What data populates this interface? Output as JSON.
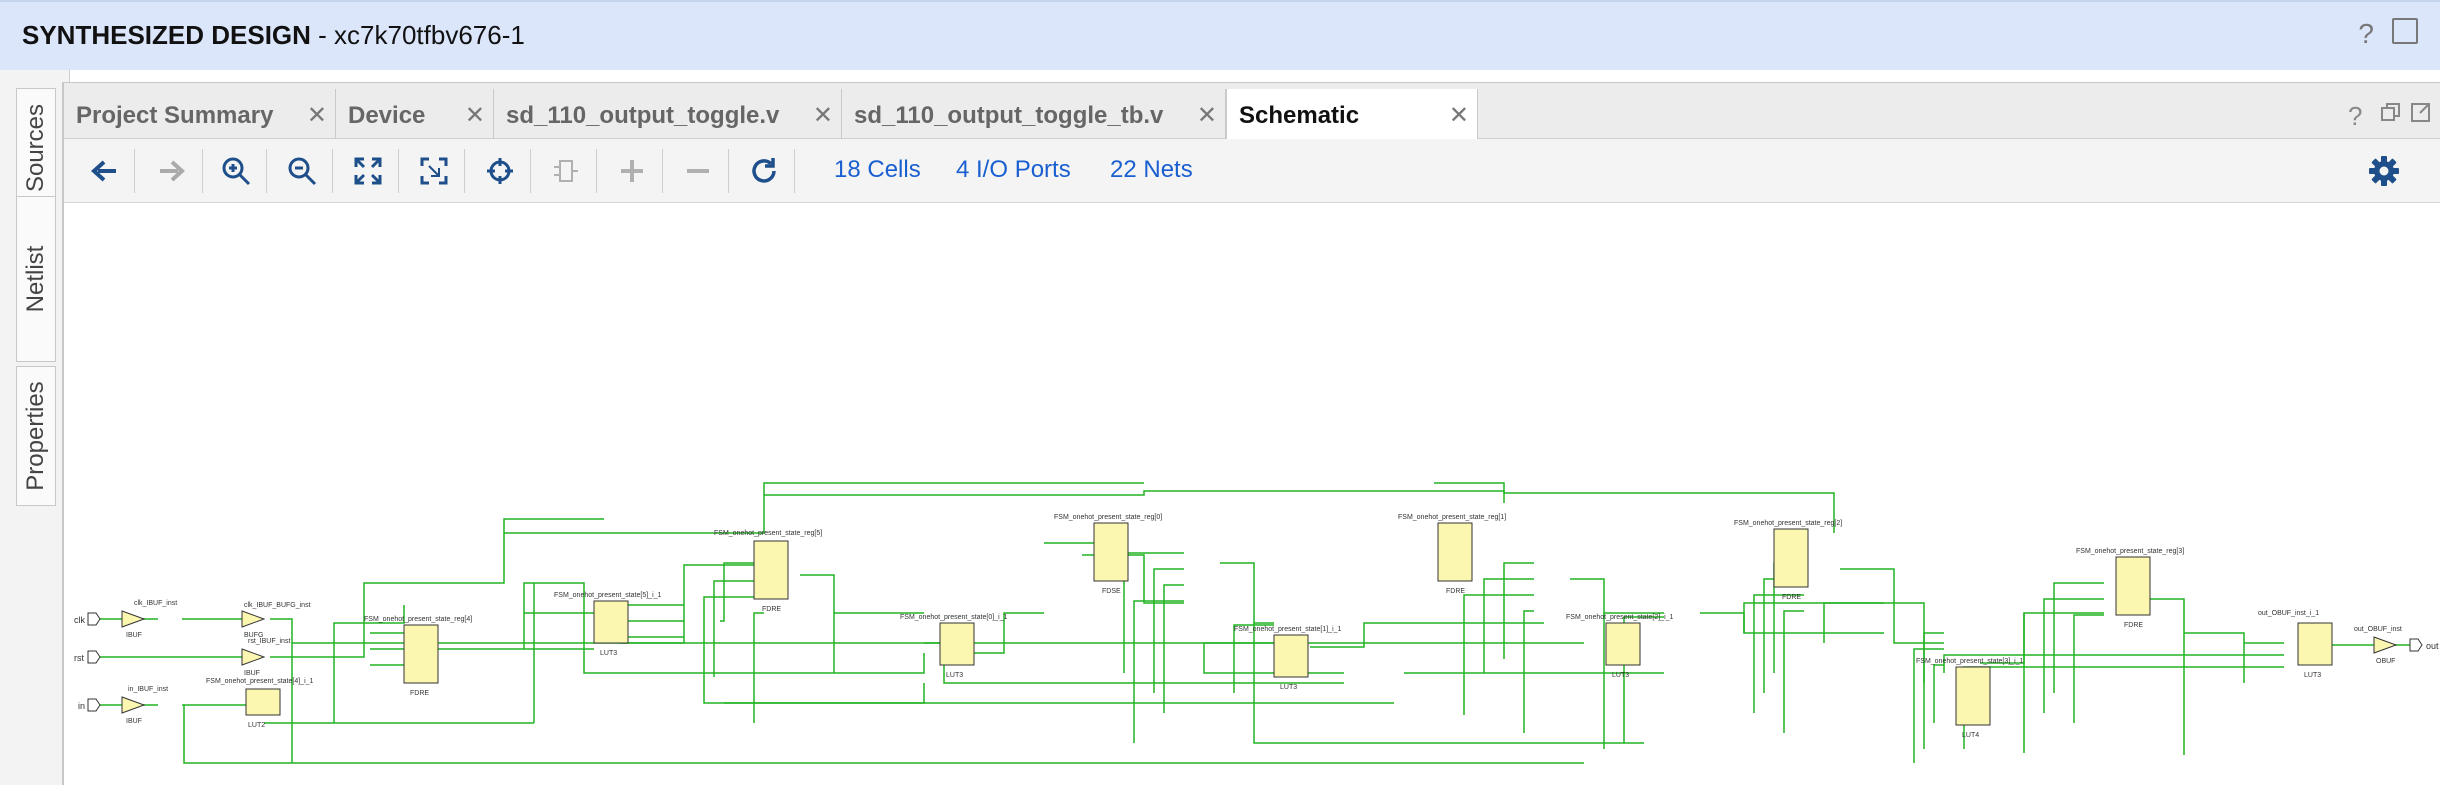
{
  "window": {
    "title_bold": "SYNTHESIZED DESIGN",
    "title_rest": " - xc7k70tfbv676-1",
    "help": "?"
  },
  "side_tabs": [
    {
      "label": "Sources"
    },
    {
      "label": "Netlist"
    },
    {
      "label": "Properties"
    }
  ],
  "tabs": [
    {
      "label": "Project Summary",
      "active": false
    },
    {
      "label": "Device",
      "active": false
    },
    {
      "label": "sd_110_output_toggle.v",
      "active": false
    },
    {
      "label": "sd_110_output_toggle_tb.v",
      "active": false
    },
    {
      "label": "Schematic",
      "active": true
    }
  ],
  "tab_controls": {
    "help": "?"
  },
  "toolbar": {
    "buttons": [
      "back-icon",
      "forward-icon",
      "zoom-in-icon",
      "zoom-out-icon",
      "zoom-fit-icon",
      "zoom-area-icon",
      "select-icon",
      "expand-cell-icon",
      "add-icon",
      "remove-icon",
      "refresh-icon"
    ],
    "cells": "18 Cells",
    "ports": "4 I/O Ports",
    "nets": "22 Nets",
    "settings_icon": "gear-icon"
  },
  "colors": {
    "wire": "#22b322",
    "cell_fill": "#fbf6b0",
    "link": "#1a5fd0"
  },
  "schematic": {
    "ports": {
      "clk": "clk",
      "rst": "rst",
      "in": "in",
      "out": "out"
    },
    "cells": [
      {
        "id": "clk_buf",
        "label": "clk_IBUF_inst",
        "type": "IBUF"
      },
      {
        "id": "clk_bufg",
        "label": "clk_IBUF_BUFG_inst",
        "type": "BUFG"
      },
      {
        "id": "rst_buf",
        "label": "rst_IBUF_inst",
        "type": "IBUF"
      },
      {
        "id": "in_buf",
        "label": "in_IBUF_inst",
        "type": "IBUF"
      },
      {
        "id": "lut4i",
        "label": "FSM_onehot_present_state[4]_i_1",
        "type": "LUT2"
      },
      {
        "id": "reg4",
        "label": "FSM_onehot_present_state_reg[4]",
        "type": "FDRE"
      },
      {
        "id": "lut5i",
        "label": "FSM_onehot_present_state[5]_i_1",
        "type": "LUT3"
      },
      {
        "id": "reg5",
        "label": "FSM_onehot_present_state_reg[5]",
        "type": "FDRE"
      },
      {
        "id": "lut0i",
        "label": "FSM_onehot_present_state[0]_i_1",
        "type": "LUT3"
      },
      {
        "id": "reg0",
        "label": "FSM_onehot_present_state_reg[0]",
        "type": "FDSE"
      },
      {
        "id": "lut1i",
        "label": "FSM_onehot_present_state[1]_i_1",
        "type": "LUT3"
      },
      {
        "id": "reg1",
        "label": "FSM_onehot_present_state_reg[1]",
        "type": "FDRE"
      },
      {
        "id": "lut2i",
        "label": "FSM_onehot_present_state[2]_i_1",
        "type": "LUT3"
      },
      {
        "id": "reg2",
        "label": "FSM_onehot_present_state_reg[2]",
        "type": "FDRE"
      },
      {
        "id": "lut3i",
        "label": "FSM_onehot_present_state[3]_i_1",
        "type": "LUT4"
      },
      {
        "id": "reg3",
        "label": "FSM_onehot_present_state_reg[3]",
        "type": "FDRE"
      },
      {
        "id": "out_lut",
        "label": "out_OBUF_inst_i_1",
        "type": "LUT3"
      },
      {
        "id": "out_buf",
        "label": "out_OBUF_inst",
        "type": "OBUF"
      }
    ]
  }
}
